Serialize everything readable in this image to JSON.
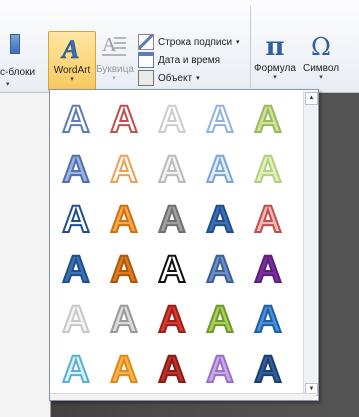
{
  "ribbon": {
    "quick_parts_label": "с-блоки",
    "wordart_label": "WordArt",
    "dropcap_label": "Буквица",
    "signature_line_label": "Строка подписи",
    "datetime_label": "Дата и время",
    "object_label": "Объект",
    "formula_label": "Формула",
    "symbol_label": "Символ",
    "formula_glyph": "π",
    "symbol_glyph": "Ω"
  },
  "gallery": {
    "styles": [
      [
        {
          "fill": "#ffffff",
          "stroke": "#5b7fb5"
        },
        {
          "fill": "#ffffff",
          "stroke": "#c0504d"
        },
        {
          "fill": "#ffffff",
          "stroke": "#cccccc"
        },
        {
          "fill": "#ffffff",
          "stroke": "#8fb4de"
        },
        {
          "fill": "#cfe0a0",
          "stroke": "#9bbb59"
        }
      ],
      [
        {
          "fill": "#9db3e0",
          "stroke": "#4f6fae"
        },
        {
          "fill": "#ffffff",
          "stroke": "#f0a050"
        },
        {
          "fill": "#f2f2f2",
          "stroke": "#bbbbbb"
        },
        {
          "fill": "#e0edf8",
          "stroke": "#7aa6d8"
        },
        {
          "fill": "#e3eec3",
          "stroke": "#b5cf7a"
        }
      ],
      [
        {
          "fill": "#ffffff",
          "stroke": "#1f4e8c"
        },
        {
          "fill": "#f5a84a",
          "stroke": "#d07010"
        },
        {
          "fill": "#a0a0a0",
          "stroke": "#707070"
        },
        {
          "fill": "#3d6fb8",
          "stroke": "#1f4e8c"
        },
        {
          "fill": "#f4b8b6",
          "stroke": "#c0504d"
        }
      ],
      [
        {
          "fill": "#3e6fb0",
          "stroke": "#1f4e8c"
        },
        {
          "fill": "#e07a1a",
          "stroke": "#a85a10"
        },
        {
          "fill": "#ffffff",
          "stroke": "#111111"
        },
        {
          "fill": "#6a8fc8",
          "stroke": "#3d5f99"
        },
        {
          "fill": "#7a2f9e",
          "stroke": "#5a1f78"
        }
      ],
      [
        {
          "fill": "#f4f4f4",
          "stroke": "#c8c8c8"
        },
        {
          "fill": "#dcdcdc",
          "stroke": "#9a9a9a"
        },
        {
          "fill": "#d8392f",
          "stroke": "#9c2018"
        },
        {
          "fill": "#a9cf5a",
          "stroke": "#6f9a2a"
        },
        {
          "fill": "#4a90d9",
          "stroke": "#1f5fa8"
        }
      ],
      [
        {
          "fill": "#d8f0f8",
          "stroke": "#5ab0d0"
        },
        {
          "fill": "#f7b24a",
          "stroke": "#e08a1a"
        },
        {
          "fill": "#c0302a",
          "stroke": "#8a1a14"
        },
        {
          "fill": "#c9a8e6",
          "stroke": "#9a70c8"
        },
        {
          "fill": "#2f5f9e",
          "stroke": "#1a3f70"
        }
      ]
    ],
    "cell_glyph": "A"
  }
}
